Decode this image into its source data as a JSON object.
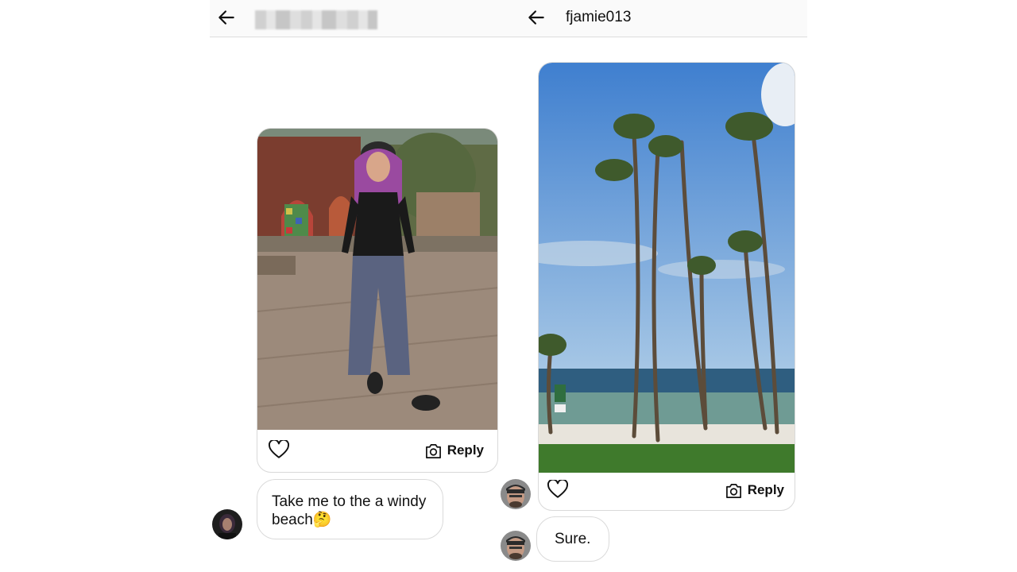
{
  "left_thread": {
    "title_redacted": true,
    "story_reply_label": "Reply",
    "message": "Take me to the a windy beach🤔"
  },
  "right_thread": {
    "title": "fjamie013",
    "story_reply_label": "Reply",
    "message": "Sure."
  },
  "icons": {
    "back": "arrow-left-icon",
    "like": "heart-outline-icon",
    "camera": "camera-icon"
  },
  "colors": {
    "header_bg": "#fafafa",
    "border": "#dadada",
    "text": "#111111"
  }
}
